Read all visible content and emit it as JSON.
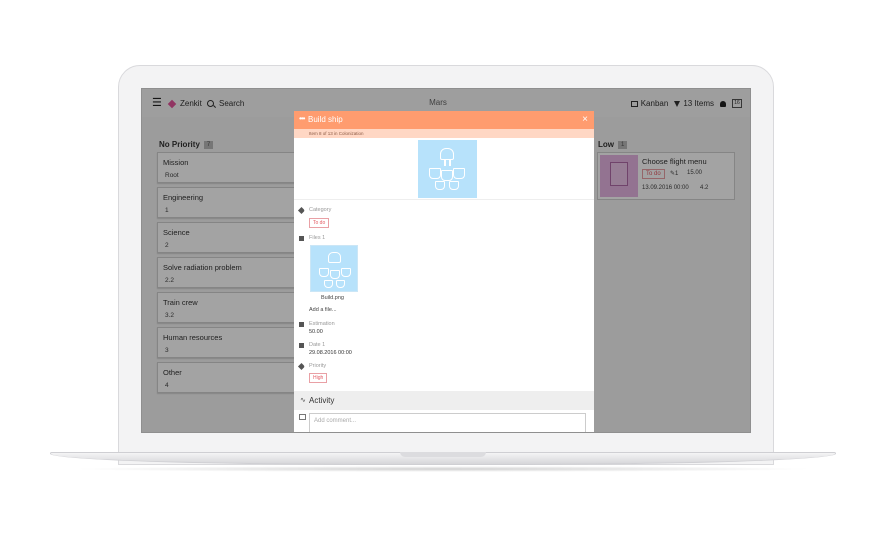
{
  "app": {
    "brand": "Zenkit",
    "search_label": "Search",
    "collection_title": "Mars",
    "view_label": "Kanban",
    "filter_label": "13 Items",
    "calendar_badge": "16"
  },
  "columns": [
    {
      "header": "No Priority",
      "count": "7",
      "cards": [
        {
          "title": "Mission",
          "value": "Root"
        },
        {
          "title": "Engineering",
          "value": "1"
        },
        {
          "title": "Science",
          "value": "2"
        },
        {
          "title": "Solve radiation problem",
          "value": "2.2"
        },
        {
          "title": "Train crew",
          "value": "3.2"
        },
        {
          "title": "Human resources",
          "value": "3"
        },
        {
          "title": "Other",
          "value": "4"
        }
      ]
    },
    {
      "header": "Low",
      "count": "1",
      "cards": [
        {
          "title": "Choose flight menu",
          "tag": "To do",
          "attachments": "1",
          "estimation": "15.00",
          "date": "13.09.2016 00:00",
          "value": "4.2"
        }
      ]
    }
  ],
  "modal": {
    "title": "Build ship",
    "subtitle": "Item 8 of 13 in Colonization",
    "category_label": "Category",
    "category_value": "To do",
    "files_label": "Files 1",
    "file_name": "Build.png",
    "add_file": "Add a file...",
    "estimation_label": "Estimation",
    "estimation_value": "50.00",
    "date_label": "Date 1",
    "date_value": "29.08.2016 00:00",
    "priority_label": "Priority",
    "priority_value": "High",
    "activity_title": "Activity",
    "comment_placeholder": "Add comment..."
  },
  "colors": {
    "modal_header": "#ff9c6f",
    "modal_subheader": "#ffd7c4",
    "tag_red": "#e35b63",
    "image_blue": "#b7e2fb",
    "brand_pink": "#e3539a"
  }
}
